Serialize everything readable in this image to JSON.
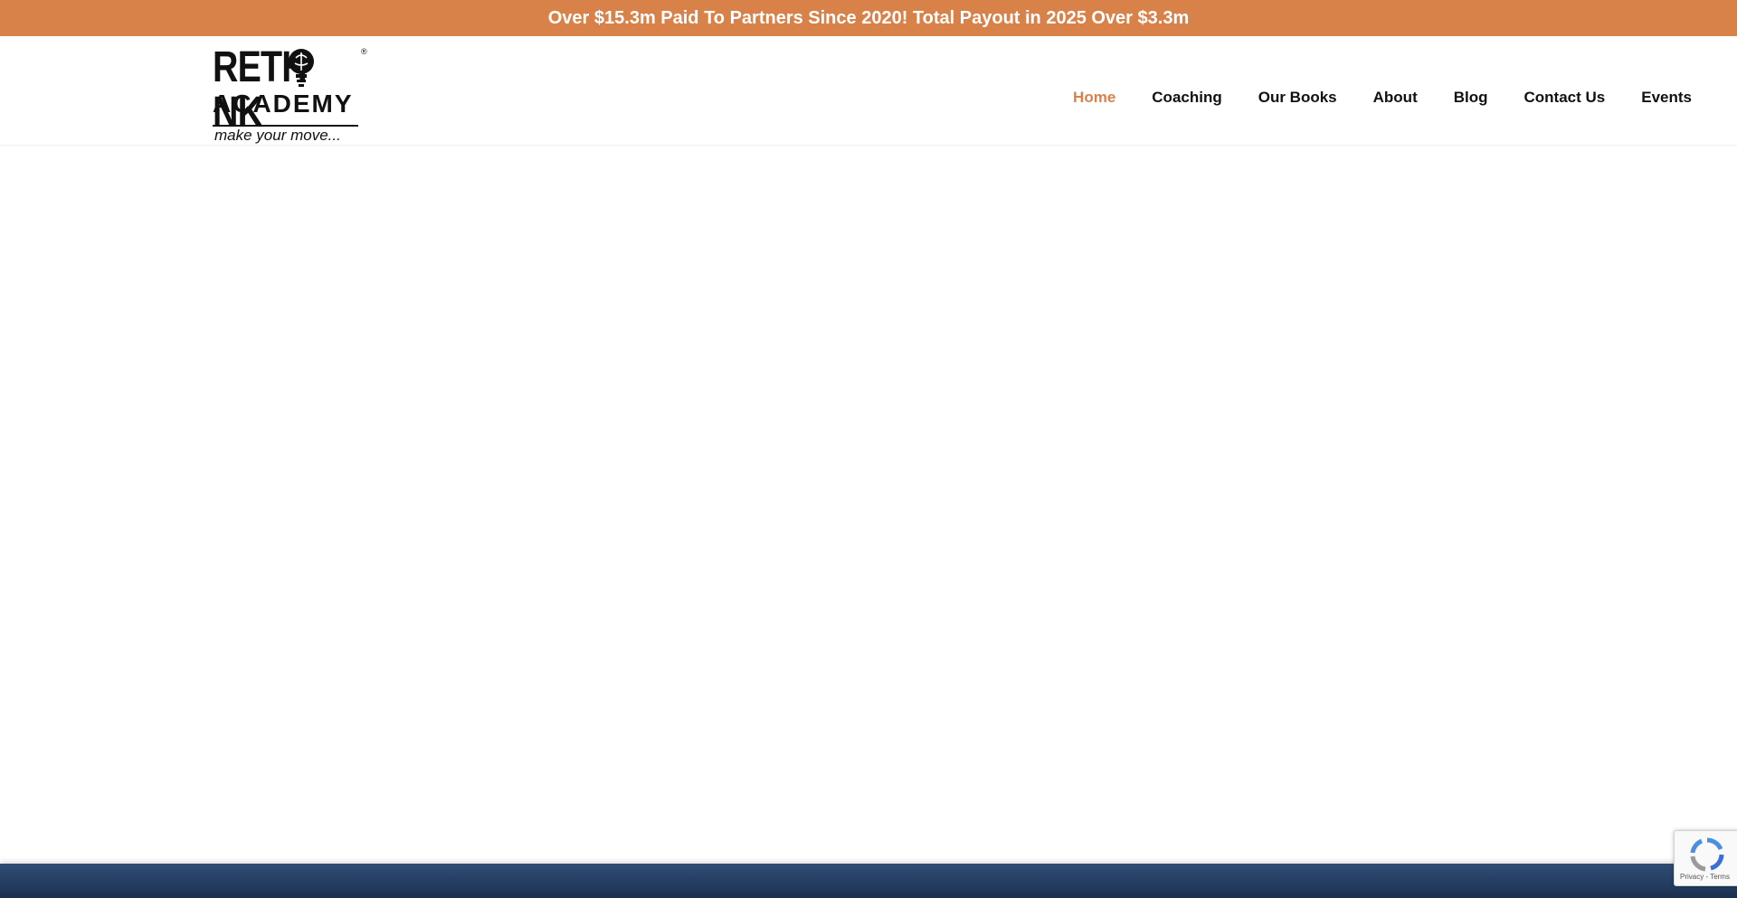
{
  "announcement": {
    "text": "Over $15.3m Paid To Partners Since 2020! Total Payout in 2025 Over $3.3m"
  },
  "logo": {
    "line1": "RETH   NK",
    "registered": "®",
    "line2": "ACADEMY",
    "tagline": "make your move..."
  },
  "nav": {
    "items": [
      {
        "label": "Home",
        "active": true
      },
      {
        "label": "Coaching",
        "active": false
      },
      {
        "label": "Our Books",
        "active": false
      },
      {
        "label": "About",
        "active": false
      },
      {
        "label": "Blog",
        "active": false
      },
      {
        "label": "Contact Us",
        "active": false
      },
      {
        "label": "Events",
        "active": false
      }
    ]
  },
  "recaptcha": {
    "links": "Privacy - Terms"
  },
  "colors": {
    "accent": "#d8824a",
    "text": "#111111",
    "footer": "#223b5d"
  }
}
